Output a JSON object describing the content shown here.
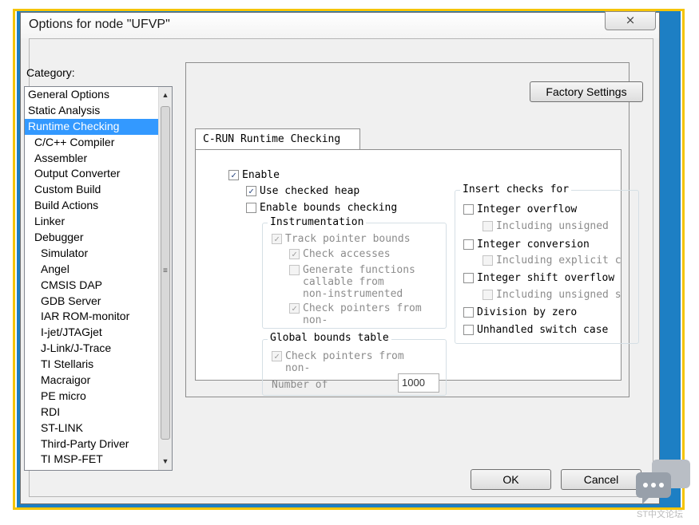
{
  "window": {
    "title": "Options for node \"UFVP\"",
    "close_glyph": "⨯"
  },
  "category": {
    "label": "Category:",
    "items": [
      {
        "label": "General Options",
        "indent": 0
      },
      {
        "label": "Static Analysis",
        "indent": 0
      },
      {
        "label": "Runtime Checking",
        "indent": 0,
        "selected": true
      },
      {
        "label": "C/C++ Compiler",
        "indent": 1
      },
      {
        "label": "Assembler",
        "indent": 1
      },
      {
        "label": "Output Converter",
        "indent": 1
      },
      {
        "label": "Custom Build",
        "indent": 1
      },
      {
        "label": "Build Actions",
        "indent": 1
      },
      {
        "label": "Linker",
        "indent": 1
      },
      {
        "label": "Debugger",
        "indent": 1
      },
      {
        "label": "Simulator",
        "indent": 2
      },
      {
        "label": "Angel",
        "indent": 2
      },
      {
        "label": "CMSIS DAP",
        "indent": 2
      },
      {
        "label": "GDB Server",
        "indent": 2
      },
      {
        "label": "IAR ROM-monitor",
        "indent": 2
      },
      {
        "label": "I-jet/JTAGjet",
        "indent": 2
      },
      {
        "label": "J-Link/J-Trace",
        "indent": 2
      },
      {
        "label": "TI Stellaris",
        "indent": 2
      },
      {
        "label": "Macraigor",
        "indent": 2
      },
      {
        "label": "PE micro",
        "indent": 2
      },
      {
        "label": "RDI",
        "indent": 2
      },
      {
        "label": "ST-LINK",
        "indent": 2
      },
      {
        "label": "Third-Party Driver",
        "indent": 2
      },
      {
        "label": "TI MSP-FET",
        "indent": 2
      }
    ]
  },
  "factory_settings": "Factory Settings",
  "tab": {
    "label": "C-RUN Runtime Checking"
  },
  "options": {
    "enable": {
      "label": "Enable",
      "checked": true
    },
    "checked_heap": {
      "label": "Use checked heap",
      "checked": true
    },
    "bounds_checking": {
      "label": "Enable bounds checking",
      "checked": false
    },
    "instrumentation": {
      "title": "Instrumentation",
      "track_pointer_bounds": {
        "label": "Track pointer bounds",
        "checked": true
      },
      "check_accesses": {
        "label": "Check accesses",
        "checked": true
      },
      "generate_functions": {
        "label_lines": [
          "Generate functions",
          "callable from",
          "non-instrumented"
        ],
        "checked": false
      },
      "check_pointers": {
        "label_lines": [
          "Check pointers from",
          "non-"
        ],
        "checked": true
      }
    },
    "global_bounds": {
      "title": "Global bounds table",
      "check_pointers": {
        "label_lines": [
          "Check pointers from",
          "non-"
        ],
        "checked": true
      },
      "number_of_label": "Number of",
      "number_value": "1000"
    },
    "insert_checks": {
      "title": "Insert checks for",
      "integer_overflow": {
        "label": "Integer overflow",
        "checked": false
      },
      "including_unsigned": {
        "label": "Including unsigned",
        "checked": false
      },
      "integer_conversion": {
        "label": "Integer conversion",
        "checked": false
      },
      "including_explicit": {
        "label": "Including explicit c",
        "checked": false
      },
      "integer_shift": {
        "label": "Integer shift overflow",
        "checked": false
      },
      "including_unsigned_shift": {
        "label": "Including unsigned s",
        "checked": false
      },
      "division_by_zero": {
        "label": "Division by zero",
        "checked": false
      },
      "unhandled_switch": {
        "label": "Unhandled switch case",
        "checked": false
      }
    }
  },
  "buttons": {
    "ok": "OK",
    "cancel": "Cancel"
  },
  "watermark": {
    "text": "ST中文论坛"
  },
  "colors": {
    "selection": "#3399ff",
    "outer_border": "#1d7fc4",
    "frame": "#f5c400"
  }
}
